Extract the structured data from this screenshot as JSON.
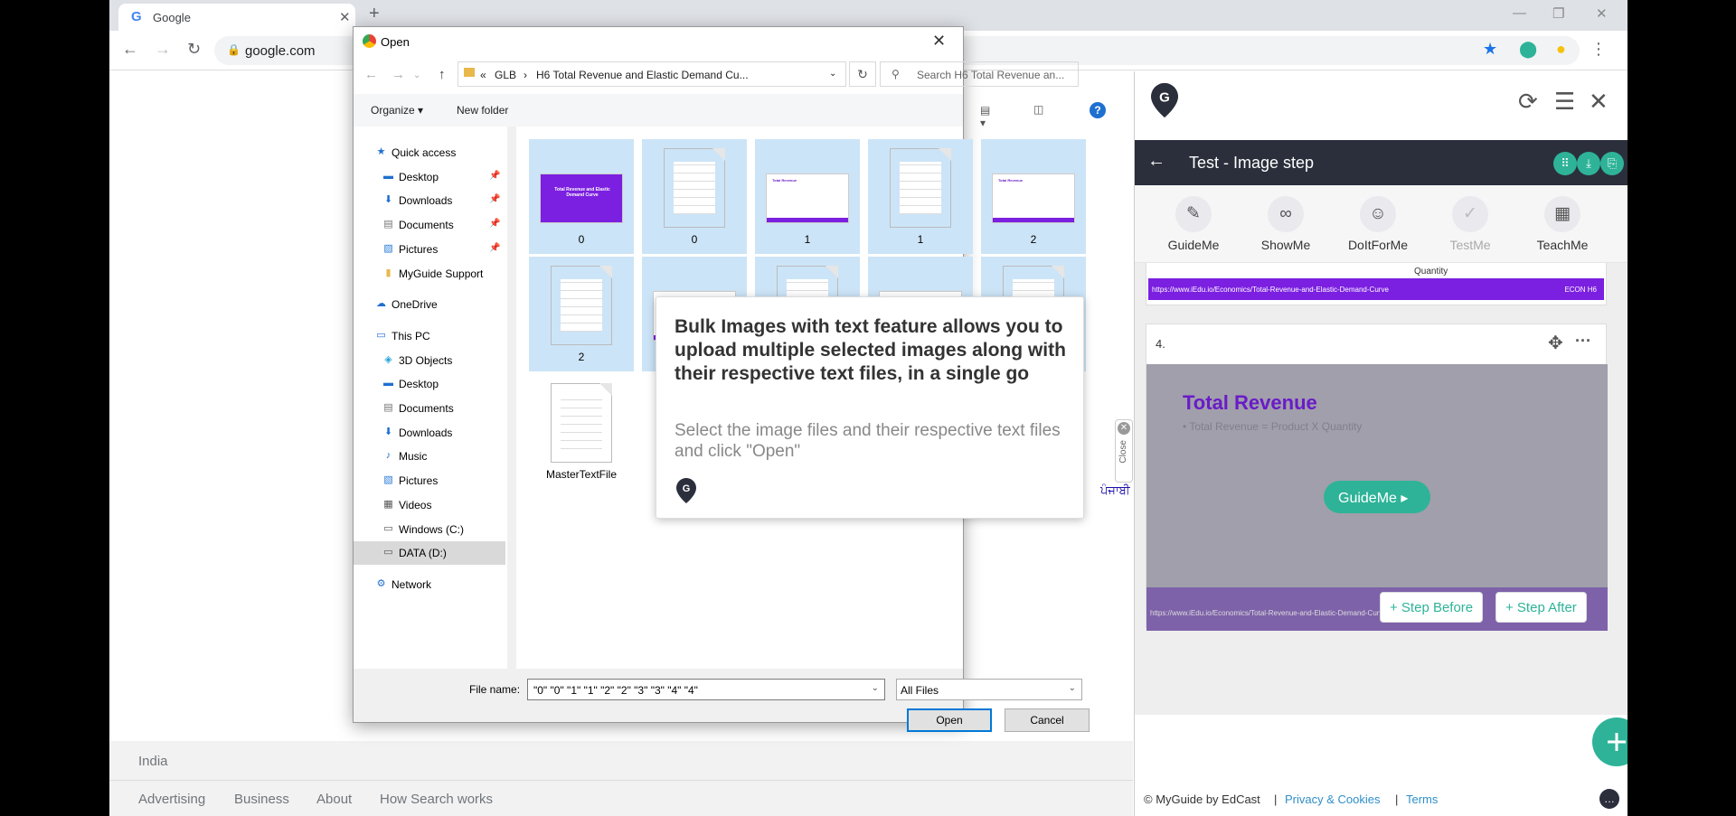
{
  "browser": {
    "tab_title": "Google",
    "tab_icon": "G",
    "new_tab": "+",
    "url": "google.com"
  },
  "google": {
    "country": "India",
    "footer_links": [
      "Advertising",
      "Business",
      "About",
      "How Search works"
    ],
    "partial_lang": "ਪੰਜਾਬੀ"
  },
  "close_tab": {
    "label": "Close"
  },
  "dialog": {
    "title": "Open",
    "breadcrumb": [
      "«",
      "GLB",
      "›",
      "H6 Total Revenue and Elastic Demand Cu..."
    ],
    "search_placeholder": "Search H6 Total Revenue an...",
    "organize": "Organize ▾",
    "new_folder": "New folder",
    "nav": [
      {
        "label": "Quick access",
        "icon": "star-icon",
        "indent": 0
      },
      {
        "label": "Desktop",
        "icon": "desktop-icon",
        "indent": 1,
        "pin": true
      },
      {
        "label": "Downloads",
        "icon": "download-icon",
        "indent": 1,
        "pin": true
      },
      {
        "label": "Documents",
        "icon": "documents-icon",
        "indent": 1,
        "pin": true
      },
      {
        "label": "Pictures",
        "icon": "pictures-icon",
        "indent": 1,
        "pin": true
      },
      {
        "label": "MyGuide Support",
        "icon": "folder-icon",
        "indent": 1
      },
      {
        "label": "OneDrive",
        "icon": "cloud-icon",
        "indent": 0
      },
      {
        "label": "This PC",
        "icon": "computer-icon",
        "indent": 0
      },
      {
        "label": "3D Objects",
        "icon": "cube-icon",
        "indent": 1
      },
      {
        "label": "Desktop",
        "icon": "desktop-icon",
        "indent": 1
      },
      {
        "label": "Documents",
        "icon": "documents-icon",
        "indent": 1
      },
      {
        "label": "Downloads",
        "icon": "download-icon",
        "indent": 1
      },
      {
        "label": "Music",
        "icon": "music-icon",
        "indent": 1
      },
      {
        "label": "Pictures",
        "icon": "pictures-icon",
        "indent": 1
      },
      {
        "label": "Videos",
        "icon": "video-icon",
        "indent": 1
      },
      {
        "label": "Windows (C:)",
        "icon": "drive-icon",
        "indent": 1
      },
      {
        "label": "DATA (D:)",
        "icon": "drive-icon",
        "indent": 1,
        "selected": true
      },
      {
        "label": "Network",
        "icon": "network-icon",
        "indent": 0
      }
    ],
    "files": [
      {
        "name": "0",
        "kind": "image-title"
      },
      {
        "name": "0",
        "kind": "text"
      },
      {
        "name": "1",
        "kind": "image-slide"
      },
      {
        "name": "1",
        "kind": "text"
      },
      {
        "name": "2",
        "kind": "image-slide"
      },
      {
        "name": "2",
        "kind": "text"
      },
      {
        "name": "",
        "kind": "image-slide"
      },
      {
        "name": "",
        "kind": "text"
      },
      {
        "name": "",
        "kind": "image-slide"
      },
      {
        "name": "",
        "kind": "text"
      },
      {
        "name": "MasterTextFile",
        "kind": "text",
        "unselected": true
      }
    ],
    "thumb_title": "Total Revenue and Elastic Demand Curve",
    "thumb_slide_title": "Total Revenue",
    "file_name_label": "File name:",
    "file_name_value": "\"0\" \"0\" \"1\" \"1\" \"2\" \"2\" \"3\" \"3\" \"4\" \"4\"",
    "filter": "All Files",
    "open": "Open",
    "cancel": "Cancel"
  },
  "tooltip": {
    "heading": "Bulk Images with text feature allows you to upload multiple selected images along with their respective text files, in a single go",
    "desc": "Select the image files and their respective text files and click \"Open\""
  },
  "panel": {
    "title": "Test - Image step",
    "modes": [
      {
        "label": "GuideMe",
        "icon": "compass-icon"
      },
      {
        "label": "ShowMe",
        "icon": "binoculars-icon"
      },
      {
        "label": "DoItForMe",
        "icon": "robot-icon"
      },
      {
        "label": "TestMe",
        "icon": "test-icon",
        "dim": true
      },
      {
        "label": "TeachMe",
        "icon": "teach-icon"
      }
    ],
    "card3_quantity": "Quantity",
    "card3_url": "https://www.iEdu.io/Economics/Total-Revenue-and-Elastic-Demand-Curve",
    "card3_brand": "ECON H6",
    "card4_num": "4.",
    "slide_title": "Total Revenue",
    "slide_bullet": "• Total Revenue = Product X Quantity",
    "slide_url": "https://www.iEdu.io/Economics/Total-Revenue-and-Elastic-Demand-Curve",
    "guideme_btn": "GuideMe ▸",
    "step_before": "+ Step Before",
    "step_after": "+ Step After",
    "footer_brand": "© MyGuide by EdCast",
    "footer_sep": "|",
    "footer_privacy": "Privacy & Cookies",
    "footer_terms": "Terms"
  },
  "colors": {
    "accent": "#2eb398",
    "purple": "#7b1fe0",
    "dark_bar": "#2b2f3c"
  }
}
